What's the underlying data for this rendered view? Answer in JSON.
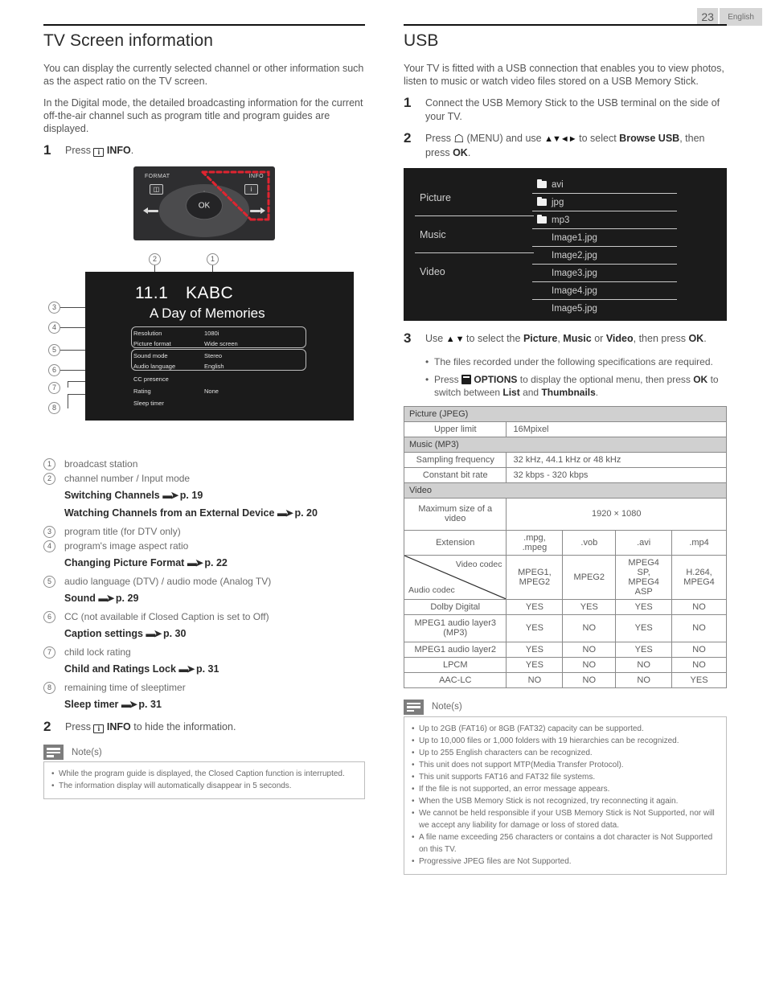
{
  "page": {
    "number": "23",
    "language": "English"
  },
  "left": {
    "title": "TV Screen information",
    "intro1": "You can display the currently selected channel or other information such as the aspect ratio on the TV screen.",
    "intro2": "In the Digital mode, the detailed broadcasting information for the current off-the-air channel such as program title and program guides are displayed.",
    "step1": {
      "num": "1",
      "press": "Press",
      "icon": "info-icon",
      "label": "INFO",
      "tail": "."
    },
    "remote": {
      "format_label": "FORMAT",
      "info_label": "INFO",
      "ok_label": "OK",
      "format_glyph": "⧉",
      "info_glyph": "i"
    },
    "tv_screen": {
      "channel": "11.1",
      "callsign": "KABC",
      "program": "A Day of Memories",
      "rows": [
        {
          "key": "Resolution",
          "value": "1080i"
        },
        {
          "key": "Picture format",
          "value": "Wide screen"
        },
        {
          "key": "Sound mode",
          "value": "Stereo"
        },
        {
          "key": "Audio language",
          "value": "English"
        },
        {
          "key": "CC presence",
          "value": ""
        },
        {
          "key": "Rating",
          "value": "None"
        },
        {
          "key": "Sleep timer",
          "value": ""
        }
      ],
      "callouts": [
        "1",
        "2",
        "3",
        "4",
        "5",
        "6",
        "7",
        "8"
      ]
    },
    "legend": [
      {
        "n": "1",
        "text": "broadcast station",
        "subs": []
      },
      {
        "n": "2",
        "text": "channel number / Input mode",
        "subs": [
          {
            "label": "Switching Channels",
            "page": "p. 19"
          },
          {
            "label": "Watching Channels from an External Device",
            "page": "p. 20"
          }
        ]
      },
      {
        "n": "3",
        "text": "program title (for DTV only)",
        "subs": []
      },
      {
        "n": "4",
        "text": "program's image aspect ratio",
        "subs": [
          {
            "label": "Changing Picture Format",
            "page": "p. 22"
          }
        ]
      },
      {
        "n": "5",
        "text": "audio language (DTV) / audio mode (Analog TV)",
        "subs": [
          {
            "label": "Sound",
            "page": "p. 29"
          }
        ]
      },
      {
        "n": "6",
        "text": "CC (not available if Closed Caption is set to Off)",
        "subs": [
          {
            "label": "Caption settings",
            "page": "p. 30"
          }
        ]
      },
      {
        "n": "7",
        "text": "child lock rating",
        "subs": [
          {
            "label": "Child and Ratings Lock",
            "page": "p. 31"
          }
        ]
      },
      {
        "n": "8",
        "text": "remaining time of sleeptimer",
        "subs": [
          {
            "label": "Sleep timer",
            "page": "p. 31"
          }
        ]
      }
    ],
    "step2": {
      "num": "2",
      "press": "Press",
      "label": "INFO",
      "tail": " to hide the information."
    },
    "notes": {
      "title": "Note(s)",
      "items": [
        "While the program guide is displayed, the Closed Caption function is interrupted.",
        "The information display will automatically disappear in 5 seconds."
      ]
    }
  },
  "right": {
    "title": "USB",
    "intro": "Your TV is fitted with a USB connection that enables you to view photos, listen to music or watch video files stored on a USB Memory Stick.",
    "step1": {
      "num": "1",
      "text": "Connect the USB Memory Stick to the USB terminal on the side of your TV."
    },
    "step2": {
      "num": "2",
      "pre": "Press",
      "menu": "(MENU)",
      "mid": "and use",
      "arrows": "▲▼◄►",
      "mid2": "to select",
      "target": "Browse USB",
      "tail": ", then press",
      "ok": "OK",
      "period": "."
    },
    "usb_mock": {
      "categories": [
        "Picture",
        "Music",
        "Video"
      ],
      "files": [
        {
          "name": "avi",
          "folder": true
        },
        {
          "name": "jpg",
          "folder": true
        },
        {
          "name": "mp3",
          "folder": true
        },
        {
          "name": "Image1.jpg",
          "folder": false
        },
        {
          "name": "Image2.jpg",
          "folder": false
        },
        {
          "name": "Image3.jpg",
          "folder": false
        },
        {
          "name": "Image4.jpg",
          "folder": false
        },
        {
          "name": "Image5.jpg",
          "folder": false
        }
      ]
    },
    "step3": {
      "num": "3",
      "pre": "Use",
      "arrows": "▲ ▼",
      "mid": "to select the",
      "opt1": "Picture",
      "opt2": "Music",
      "or": "or",
      "opt3": "Video",
      "tail": ", then press",
      "ok": "OK",
      "period": ".",
      "bullets": [
        {
          "type": "plain",
          "text": "The files recorded under the following specifications are required."
        },
        {
          "type": "rich",
          "pre": "Press",
          "icon_label": "OPTIONS",
          "mid": "to display the optional menu, then press",
          "ok": "OK",
          "mid2": "to switch between",
          "b1": "List",
          "and": "and",
          "b2": "Thumbnails",
          "period": "."
        }
      ]
    },
    "spec_table": {
      "sections": [
        {
          "header": "Picture (JPEG)",
          "rows": [
            {
              "label": "Upper limit",
              "value": "16Mpixel"
            }
          ]
        },
        {
          "header": "Music (MP3)",
          "rows": [
            {
              "label": "Sampling frequency",
              "value": "32 kHz, 44.1 kHz or 48 kHz"
            },
            {
              "label": "Constant bit rate",
              "value": "32 kbps - 320 kbps"
            }
          ]
        },
        {
          "header": "Video",
          "rows": [
            {
              "label": "Maximum size of a video",
              "value": "1920 × 1080"
            }
          ]
        }
      ],
      "extension_label": "Extension",
      "extensions": [
        ".mpg, .mpeg",
        ".vob",
        ".avi",
        ".mp4"
      ],
      "video_codec_label": "Video codec",
      "audio_codec_label": "Audio codec",
      "video_codecs": [
        "MPEG1, MPEG2",
        "MPEG2",
        "MPEG4 SP, MPEG4 ASP",
        "H.264, MPEG4"
      ],
      "audio_rows": [
        {
          "label": "Dolby Digital",
          "values": [
            "YES",
            "YES",
            "YES",
            "NO"
          ]
        },
        {
          "label": "MPEG1 audio layer3 (MP3)",
          "values": [
            "YES",
            "NO",
            "YES",
            "NO"
          ]
        },
        {
          "label": "MPEG1 audio layer2",
          "values": [
            "YES",
            "NO",
            "YES",
            "NO"
          ]
        },
        {
          "label": "LPCM",
          "values": [
            "YES",
            "NO",
            "NO",
            "NO"
          ]
        },
        {
          "label": "AAC-LC",
          "values": [
            "NO",
            "NO",
            "NO",
            "YES"
          ]
        }
      ]
    },
    "notes": {
      "title": "Note(s)",
      "items": [
        "Up to 2GB (FAT16) or 8GB (FAT32) capacity can be supported.",
        "Up to 10,000 files or 1,000 folders with 19 hierarchies can be recognized.",
        "Up to 255 English characters can be recognized.",
        "This unit does not support MTP(Media Transfer Protocol).",
        "This unit supports FAT16 and FAT32 file systems.",
        "If the file is not supported, an error message appears.",
        "When the USB Memory Stick is not recognized, try reconnecting it again.",
        "We cannot be held responsible if your USB Memory Stick is Not Supported, nor will we accept any liability for damage or loss of stored data.",
        "A file name exceeding 256 characters or contains a dot character is Not Supported on this TV.",
        "Progressive JPEG files are Not Supported."
      ]
    }
  }
}
